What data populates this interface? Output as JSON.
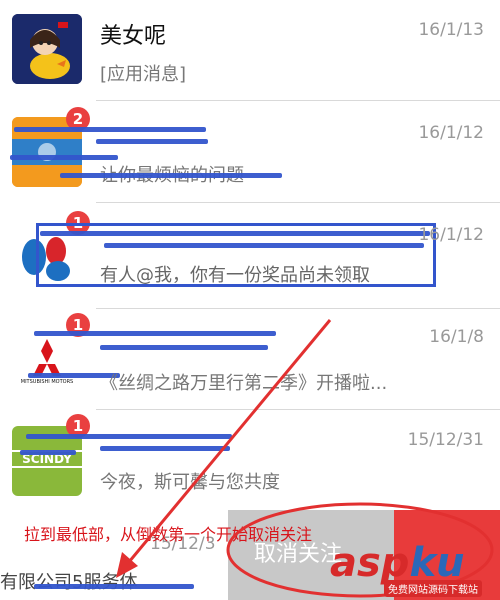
{
  "conversations": [
    {
      "title": "美女呢",
      "preview": "[应用消息]",
      "time": "16/1/13",
      "badge": ""
    },
    {
      "title": "",
      "preview": "让你最烦恼的问题",
      "time": "16/1/12",
      "badge": "2"
    },
    {
      "title": "",
      "preview": "有人@我，你有一份奖品尚未领取",
      "time": "16/1/12",
      "badge": "1"
    },
    {
      "title": "",
      "preview": "《丝绸之路万里行第二季》开播啦...",
      "time": "16/1/8",
      "badge": "1",
      "logo_text": "MITSUBISHI MOTORS"
    },
    {
      "title": "",
      "preview": "今夜，斯可馨与您共度",
      "time": "15/12/31",
      "badge": "1",
      "logo_text": "SCINDY"
    }
  ],
  "bottom": {
    "instruction": "拉到最低部，从倒数第一个开始取消关注",
    "partial_name": "有限公司5服务体",
    "partial_date": "15/12/3",
    "cancel_button": "取消关注"
  },
  "watermark": {
    "main_a": "asp",
    "main_k": "ku",
    "sub": "免费网站源码下载站"
  },
  "colors": {
    "scribble": "#3355cc",
    "badge": "#e94040",
    "annotation": "#d8141b",
    "delete": "#e83b3b"
  }
}
